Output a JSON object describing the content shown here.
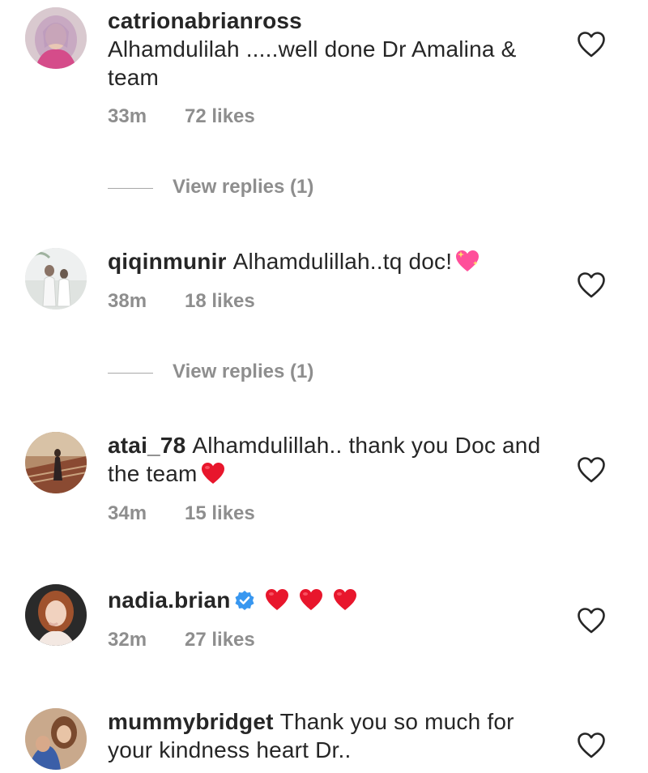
{
  "comments": [
    {
      "username": "catrionabrianross",
      "text": "Alhamdulilah .....well done Dr Amalina & team",
      "time": "33m",
      "likes": "72 likes",
      "view_replies": "View replies (1)"
    },
    {
      "username": "qiqinmunir",
      "text": "Alhamdulillah..tq doc!",
      "time": "38m",
      "likes": "18 likes",
      "view_replies": "View replies (1)"
    },
    {
      "username": "atai_78",
      "text": "Alhamdulillah.. thank you Doc and the team",
      "time": "34m",
      "likes": "15 likes"
    },
    {
      "username": "nadia.brian",
      "text": "",
      "time": "32m",
      "likes": "27 likes"
    },
    {
      "username": "mummybridget",
      "text": "Thank you so much for your kindness heart Dr.."
    }
  ],
  "colors": {
    "text": "#262626",
    "muted": "#8e8e8e",
    "verified": "#3897f0",
    "emoji_red": "#e8162c",
    "emoji_pink": "#ff4f9a"
  },
  "icons": {
    "like": "heart-outline-icon",
    "verified": "verified-badge-icon",
    "emoji_heart": "red-heart-emoji",
    "emoji_sparkle": "sparkling-heart-emoji"
  }
}
